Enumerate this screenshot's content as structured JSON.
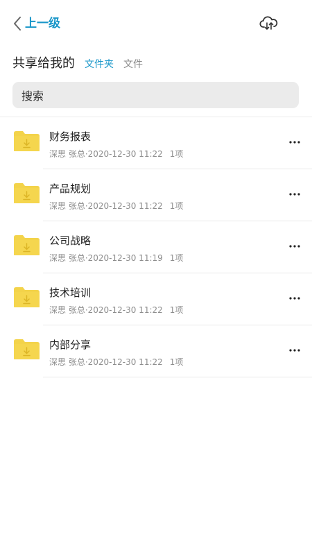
{
  "header": {
    "back_label": "上一级",
    "back_icon": "chevron-left-icon",
    "cloud_icon": "cloud-download-icon",
    "accent_color": "#1a97c9"
  },
  "title_bar": {
    "title": "共享给我的",
    "tabs": [
      {
        "label": "文件夹",
        "active": true
      },
      {
        "label": "文件",
        "active": false
      }
    ]
  },
  "search": {
    "placeholder": "搜索"
  },
  "folders": [
    {
      "name": "财务报表",
      "meta": "深思 张总·2020-12-30 11:22",
      "count": "1项"
    },
    {
      "name": "产品规划",
      "meta": "深思 张总·2020-12-30 11:22",
      "count": "1项"
    },
    {
      "name": "公司战略",
      "meta": "深思 张总·2020-12-30 11:19",
      "count": "1项"
    },
    {
      "name": "技术培训",
      "meta": "深思 张总·2020-12-30 11:22",
      "count": "1项"
    },
    {
      "name": "内部分享",
      "meta": "深思 张总·2020-12-30 11:22",
      "count": "1项"
    }
  ],
  "folder_icon": "folder-download-icon",
  "more_icon": "more-dots-icon",
  "folder_color": "#f3d34a"
}
